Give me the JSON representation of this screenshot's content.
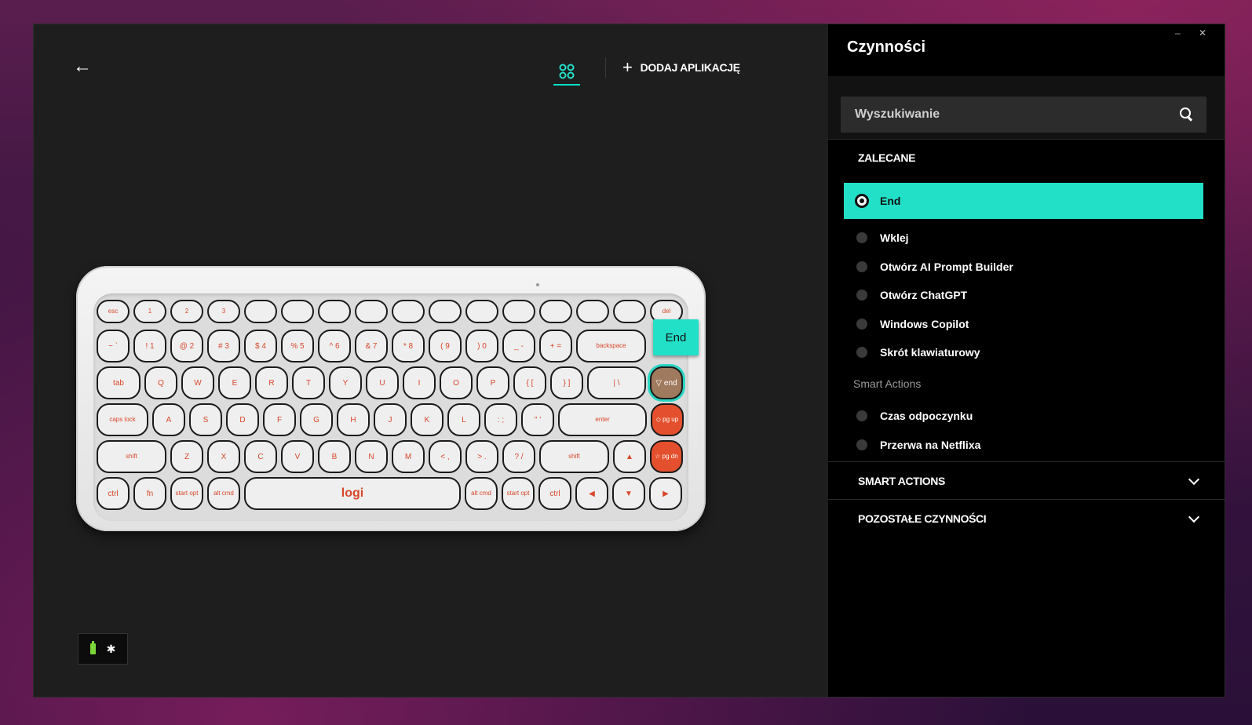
{
  "window": {
    "minimize": "–",
    "close": "✕"
  },
  "header": {
    "add_app_label": "DODAJ APLIKACJĘ",
    "plus": "+",
    "back": "←"
  },
  "keyboard": {
    "tooltip": "End",
    "rows": [
      [
        "esc",
        "1",
        "2",
        "3",
        "",
        "",
        "",
        "",
        "",
        "",
        "",
        "",
        "",
        "",
        "",
        "del"
      ],
      [
        "~ `",
        "! 1",
        "@ 2",
        "# 3",
        "$ 4",
        "% 5",
        "^ 6",
        "& 7",
        "* 8",
        "( 9",
        ") 0",
        "_ -",
        "+ =",
        "backspace"
      ],
      [
        "tab",
        "Q",
        "W",
        "E",
        "R",
        "T",
        "Y",
        "U",
        "I",
        "O",
        "P",
        "{ [",
        "} ]",
        "| \\",
        "end"
      ],
      [
        "caps lock",
        "A",
        "S",
        "D",
        "F",
        "G",
        "H",
        "J",
        "K",
        "L",
        ": ;",
        "\" '",
        "enter",
        "pg up"
      ],
      [
        "shift",
        "Z",
        "X",
        "C",
        "V",
        "B",
        "N",
        "M",
        "< ,",
        "> .",
        "? /",
        "shift",
        "▲",
        "pg dn"
      ],
      [
        "ctrl",
        "fn",
        "start opt",
        "alt cmd",
        "logi",
        "alt cmd",
        "start opt",
        "ctrl",
        "◀",
        "▼",
        "▶"
      ]
    ]
  },
  "status": {
    "bluetooth": "✱"
  },
  "panel": {
    "title": "Czynności",
    "search_placeholder": "Wyszukiwanie",
    "recommended_header": "ZALECANE",
    "recommended": [
      "End",
      "Wklej",
      "Otwórz AI Prompt Builder",
      "Otwórz ChatGPT",
      "Windows Copilot",
      "Skrót klawiaturowy"
    ],
    "smart_sub_header": "Smart Actions",
    "smart_items": [
      "Czas odpoczynku",
      "Przerwa na Netflixa"
    ],
    "collapsed_sections": [
      "SMART ACTIONS",
      "POZOSTAŁE CZYNNOŚCI"
    ]
  },
  "colors": {
    "accent": "#22e0c8",
    "key_text": "#d8472a",
    "orange_key": "#e4502d"
  }
}
